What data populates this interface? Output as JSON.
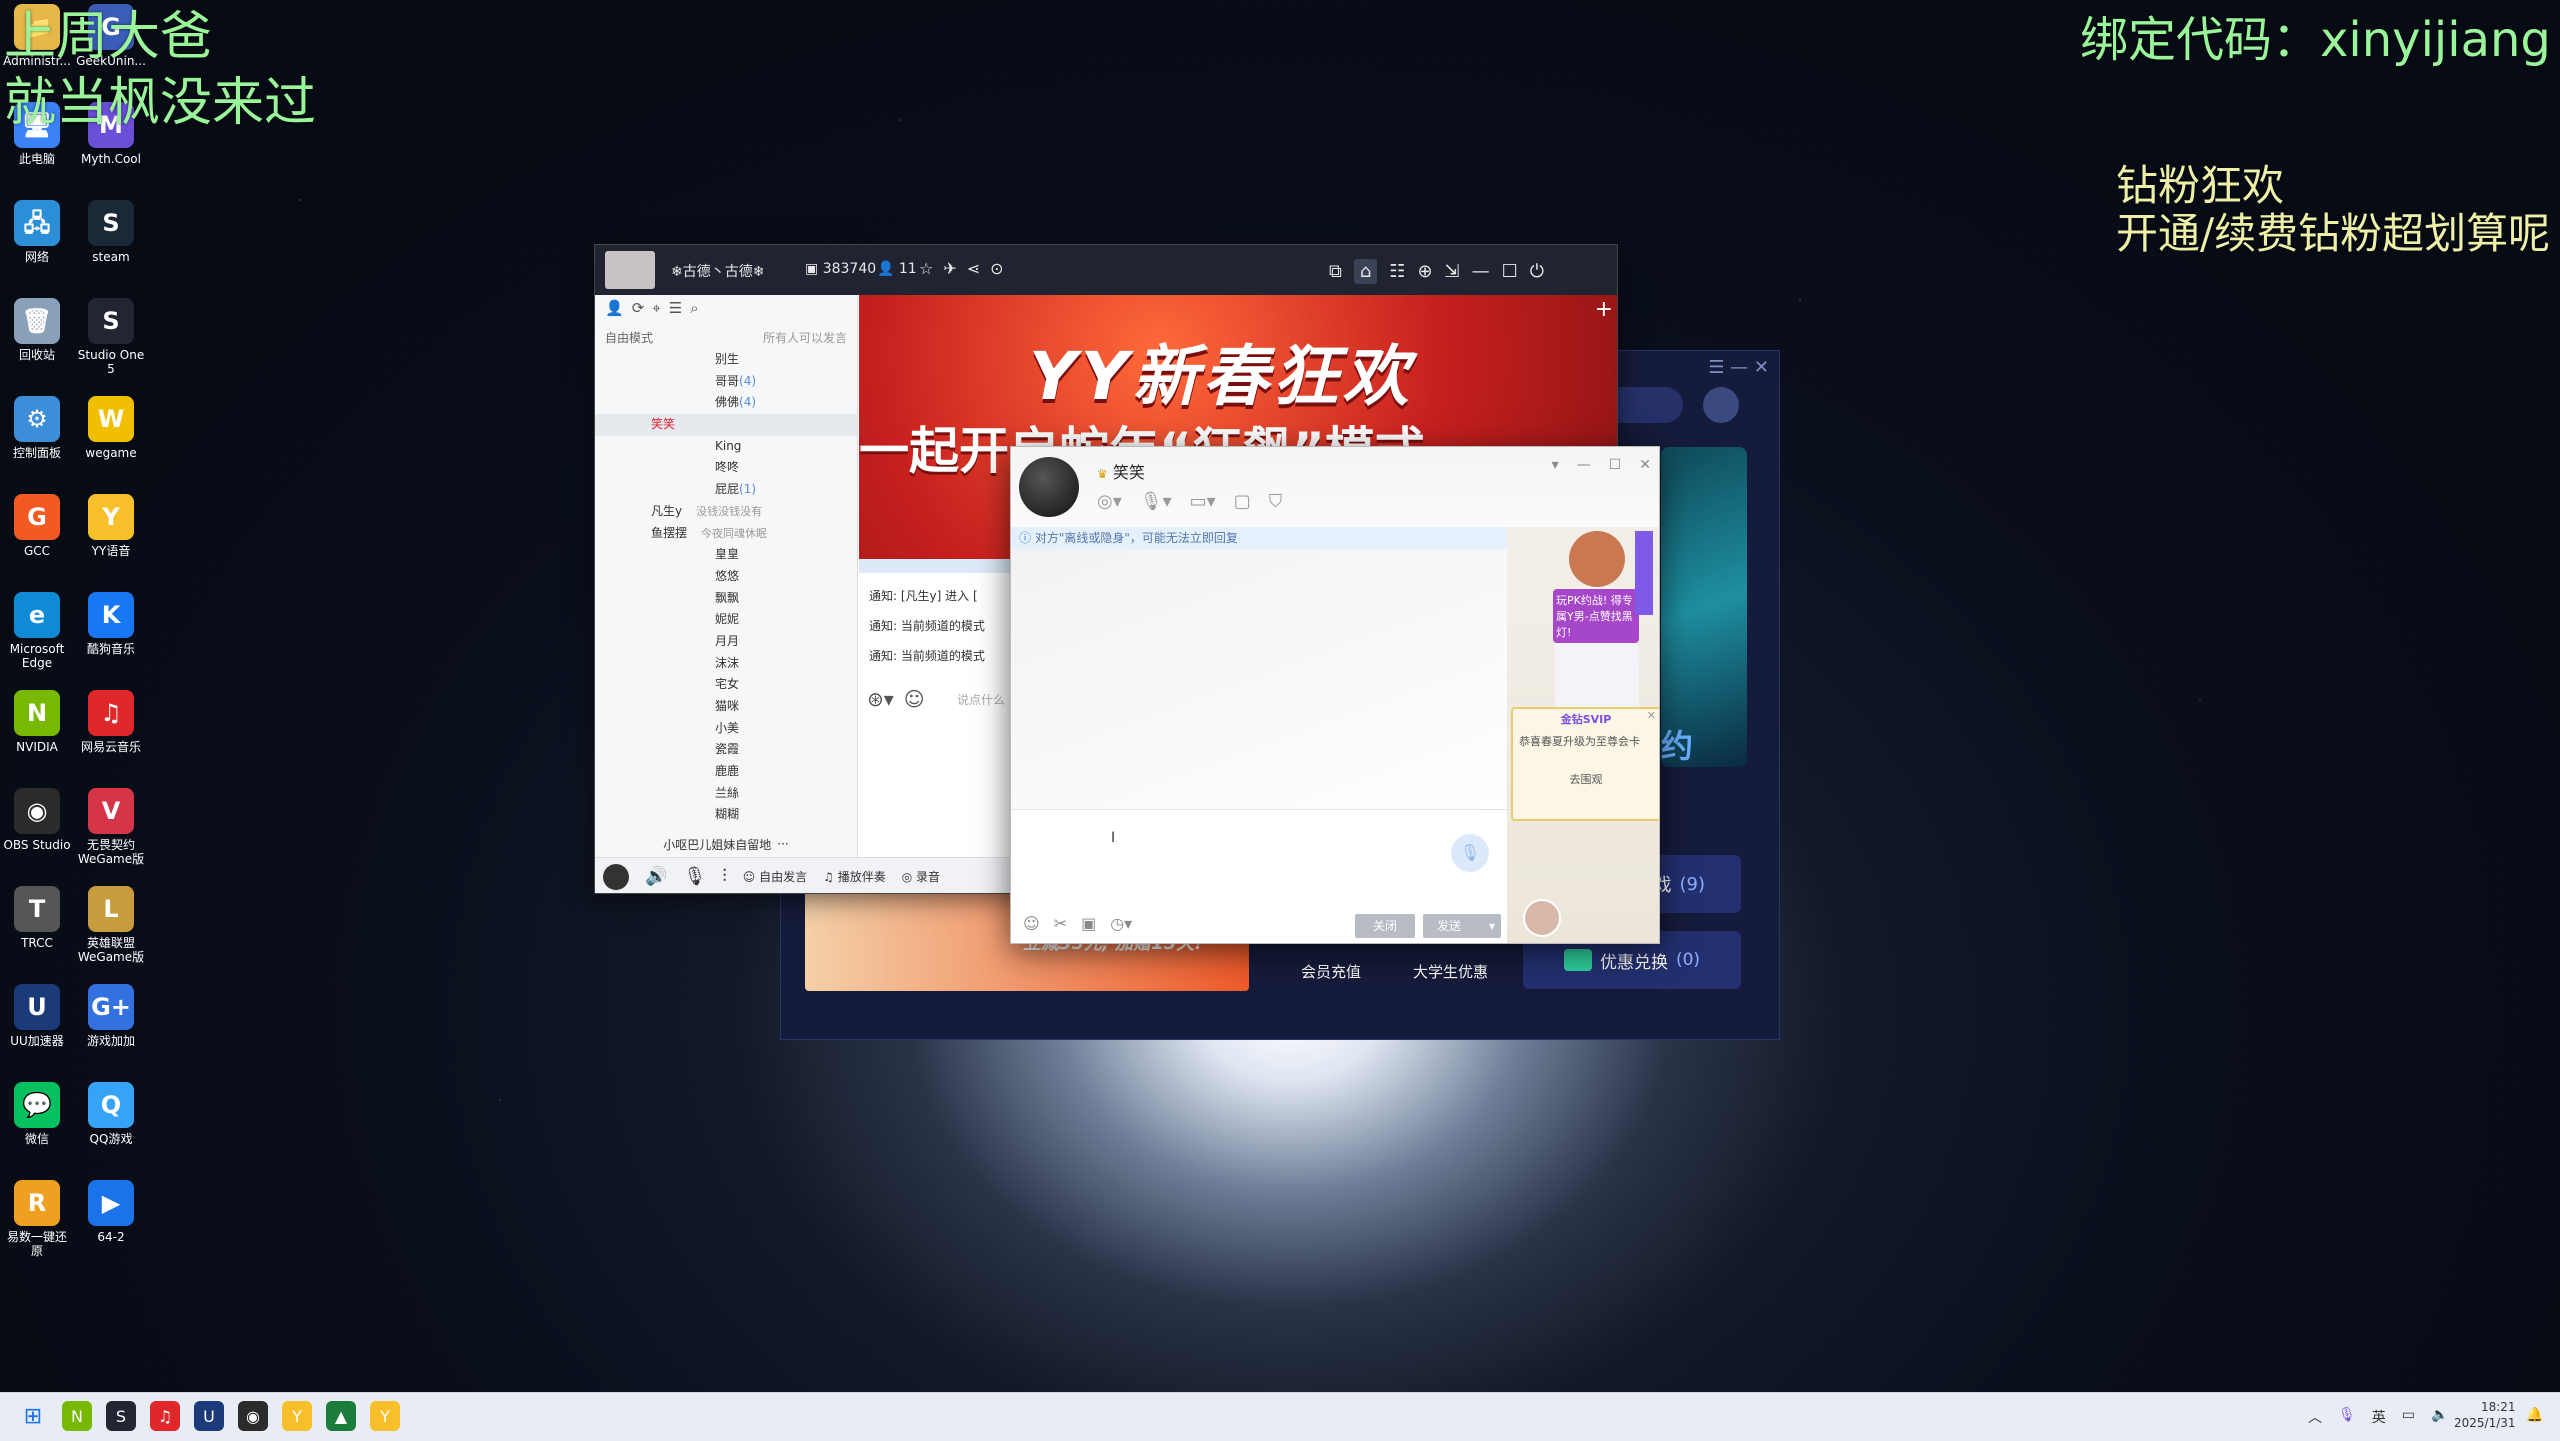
{
  "overlays": {
    "top_left_1": "上周大爸",
    "top_left_2": "就当枫没来过",
    "top_right_bind": "绑定代码：xinyijiang",
    "right_line1": "钻粉狂欢",
    "right_line2": "开通/续费钻粉超划算呢"
  },
  "desktop_icons": [
    {
      "label": "Administr...",
      "glyph": "📁",
      "color": "#e6b84a"
    },
    {
      "label": "GeekUnin...",
      "glyph": "G",
      "color": "#3a5db8"
    },
    {
      "label": "此电脑",
      "glyph": "🖥",
      "color": "#3b82f6"
    },
    {
      "label": "Myth.Cool",
      "glyph": "M",
      "color": "#6b4fd6"
    },
    {
      "label": "网络",
      "glyph": "🖧",
      "color": "#2b8fd8"
    },
    {
      "label": "steam",
      "glyph": "S",
      "color": "#1b2838"
    },
    {
      "label": "回收站",
      "glyph": "🗑",
      "color": "#8aa0b8"
    },
    {
      "label": "Studio One 5",
      "glyph": "S",
      "color": "#222633"
    },
    {
      "label": "控制面板",
      "glyph": "⚙",
      "color": "#3c8ed8"
    },
    {
      "label": "wegame",
      "glyph": "W",
      "color": "#f0c000"
    },
    {
      "label": "GCC",
      "glyph": "G",
      "color": "#f25a22"
    },
    {
      "label": "YY语音",
      "glyph": "Y",
      "color": "#f7c02b"
    },
    {
      "label": "Microsoft Edge",
      "glyph": "e",
      "color": "#0f8bd6"
    },
    {
      "label": "酷狗音乐",
      "glyph": "K",
      "color": "#1877f2"
    },
    {
      "label": "NVIDIA",
      "glyph": "N",
      "color": "#76b900"
    },
    {
      "label": "网易云音乐",
      "glyph": "♫",
      "color": "#e0282b"
    },
    {
      "label": "OBS Studio",
      "glyph": "◉",
      "color": "#2b2b2b"
    },
    {
      "label": "无畏契约 WeGame版",
      "glyph": "V",
      "color": "#d63447"
    },
    {
      "label": "TRCC",
      "glyph": "T",
      "color": "#555"
    },
    {
      "label": "英雄联盟 WeGame版",
      "glyph": "L",
      "color": "#c89b3c"
    },
    {
      "label": "UU加速器",
      "glyph": "U",
      "color": "#1b3a7a"
    },
    {
      "label": "游戏加加",
      "glyph": "G+",
      "color": "#3370e0"
    },
    {
      "label": "微信",
      "glyph": "💬",
      "color": "#07c160"
    },
    {
      "label": "QQ游戏",
      "glyph": "Q",
      "color": "#36a3f7"
    },
    {
      "label": "易数一键还原",
      "glyph": "R",
      "color": "#f0a020"
    },
    {
      "label": "64-2",
      "glyph": "▶",
      "color": "#1a73e8"
    }
  ],
  "yy": {
    "channel_name": "❄古德丶古德❄",
    "channel_id": "383740",
    "online_count": "11",
    "mode_label": "自由模式",
    "mode_right": "所有人可以发言",
    "members": [
      {
        "name": "别生",
        "badge": ""
      },
      {
        "name": "哥哥",
        "badge": "(4)"
      },
      {
        "name": "佛佛",
        "badge": "(4)"
      },
      {
        "name": "笑笑",
        "badge": "",
        "highlight": true
      },
      {
        "name": "King",
        "badge": ""
      },
      {
        "name": "咚咚",
        "badge": ""
      },
      {
        "name": "屁屁",
        "badge": "(1)"
      },
      {
        "name": "凡生y",
        "badge": "",
        "note": "没钱没钱没有"
      },
      {
        "name": "鱼摆摆",
        "badge": "",
        "note": "今夜同魂休眠"
      },
      {
        "name": "皇皇",
        "badge": ""
      },
      {
        "name": "悠悠",
        "badge": ""
      },
      {
        "name": "飘飘",
        "badge": ""
      },
      {
        "name": "妮妮",
        "badge": ""
      },
      {
        "name": "月月",
        "badge": ""
      },
      {
        "name": "沫沫",
        "badge": ""
      },
      {
        "name": "宅女",
        "badge": ""
      },
      {
        "name": "猫咪",
        "badge": ""
      },
      {
        "name": "小美",
        "badge": ""
      },
      {
        "name": "瓷霞",
        "badge": ""
      },
      {
        "name": "鹿鹿",
        "badge": ""
      },
      {
        "name": "兰絲",
        "badge": ""
      },
      {
        "name": "糊糊",
        "badge": ""
      }
    ],
    "bottom_group": "小呕巴儿姐妹自留地",
    "banner_text": "YY新春狂欢",
    "banner_sub": "一起开启蛇年“狂飙”模式",
    "notices": [
      "通知: [凡生y] 进入 [",
      "通知: 当前频道的模式",
      "通知: 当前频道的模式"
    ],
    "chat_placeholder": "说点什么",
    "bottom_free_speak": "自由发言",
    "bottom_accompany": "播放伴奏",
    "bottom_record": "录音"
  },
  "chat": {
    "title": "笑笑",
    "offline_notice": "对方\"离线或隐身\"，可能无法立即回复",
    "close_btn": "关闭",
    "send_btn": "发送",
    "ad_text1": "玩PK约战! 得专属Y男-点赞找黑灯!",
    "svip_title": "金钻SVIP",
    "svip_desc": "恭喜春夏升级为至尊会卡",
    "svip_btn": "去围观"
  },
  "bg_window": {
    "banner_promo": "立减35元, 加赠15天!",
    "member_recharge": "会员充值",
    "student_discount": "大学生优惠",
    "redeem": "优惠兑换",
    "redeem_count": "(0)",
    "game_count": "(9)",
    "game_label": "戏"
  },
  "taskbar": {
    "lang": "英",
    "time": "18:21",
    "date": "2025/1/31"
  },
  "colors": {
    "overlay_green": "#9af59a",
    "overlay_yellow": "#eef0a8",
    "yy_titlebar": "#1f2430",
    "banner_red": "#c8201f",
    "accent_blue": "#3b7fd6"
  }
}
